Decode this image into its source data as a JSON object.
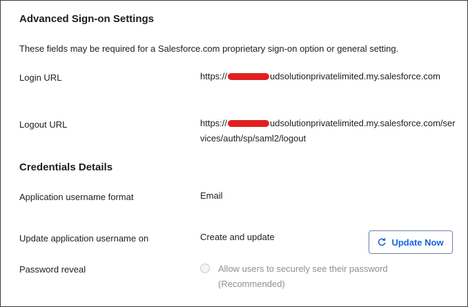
{
  "sections": {
    "advanced_title": "Advanced Sign-on Settings",
    "advanced_desc": "These fields may be required for a Salesforce.com proprietary sign-on option or general setting.",
    "credentials_title": "Credentials Details"
  },
  "fields": {
    "login_url": {
      "label": "Login URL",
      "value_start": "https://",
      "value_end": "udsolutionprivatelimited.my.salesforce.com"
    },
    "logout_url": {
      "label": "Logout URL",
      "value_start": "https://",
      "value_end": "udsolutionprivatelimited.my.salesforce.com/services/auth/sp/saml2/logout"
    },
    "username_format": {
      "label": "Application username format",
      "value": "Email"
    },
    "update_username": {
      "label": "Update application username on",
      "value": "Create and update",
      "button_label": "Update Now"
    },
    "password_reveal": {
      "label": "Password reveal",
      "checkbox_label": "Allow users to securely see their password (Recommended)",
      "checked": false
    }
  },
  "icons": {
    "update_button_icon": "refresh-icon"
  },
  "colors": {
    "accent": "#1662dd",
    "redaction": "#e02020",
    "disabled_text": "#8e8e96"
  }
}
